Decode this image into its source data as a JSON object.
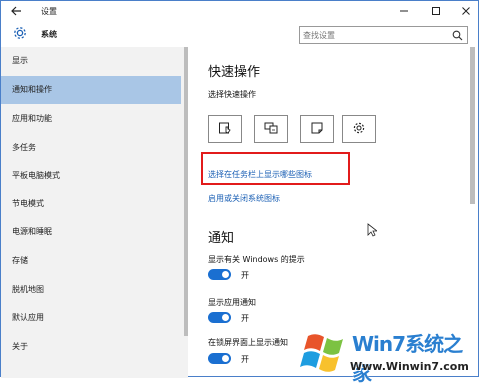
{
  "window": {
    "title": "设置",
    "controls": {
      "minimize": "—",
      "maximize": "☐",
      "close": "✕"
    }
  },
  "header": {
    "title": "系统",
    "search_placeholder": "查找设置"
  },
  "sidebar": {
    "items": [
      {
        "label": "显示",
        "active": false
      },
      {
        "label": "通知和操作",
        "active": true
      },
      {
        "label": "应用和功能",
        "active": false
      },
      {
        "label": "多任务",
        "active": false
      },
      {
        "label": "平板电脑模式",
        "active": false
      },
      {
        "label": "节电模式",
        "active": false
      },
      {
        "label": "电源和睡眠",
        "active": false
      },
      {
        "label": "存储",
        "active": false
      },
      {
        "label": "脱机地图",
        "active": false
      },
      {
        "label": "默认应用",
        "active": false
      },
      {
        "label": "关于",
        "active": false
      }
    ]
  },
  "content": {
    "quick_actions_heading": "快速操作",
    "quick_actions_label": "选择快速操作",
    "quick_buttons": [
      {
        "icon": "tablet-mode-icon"
      },
      {
        "icon": "project-icon"
      },
      {
        "icon": "note-icon"
      },
      {
        "icon": "settings-gear-icon"
      }
    ],
    "link_taskbar_icons": "选择在任务栏上显示哪些图标",
    "link_system_icons": "启用或关闭系统图标",
    "notifications_heading": "通知",
    "settings": [
      {
        "label": "显示有关 Windows 的提示",
        "state": "开",
        "on": true
      },
      {
        "label": "显示应用通知",
        "state": "开",
        "on": true
      },
      {
        "label": "在锁屏界面上显示通知",
        "state": "开",
        "on": true
      }
    ]
  },
  "watermark": {
    "brand": "Win7系统之家",
    "url": "Www.Winwin7.com"
  },
  "colors": {
    "accent": "#1a6fd1",
    "active_nav": "#a9c6e6",
    "highlight": "#e21b1b",
    "link": "#1a5fb4"
  }
}
